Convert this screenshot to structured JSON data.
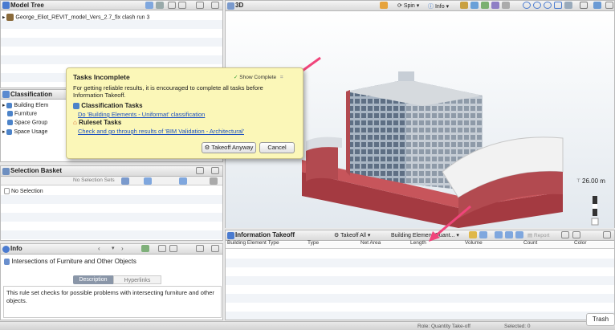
{
  "model_tree": {
    "title": "Model Tree",
    "item": "George_Eliot_REVIT_model_Vers_2.7_fix clash run 3"
  },
  "classification": {
    "title": "Classification",
    "items": [
      "Building Elem",
      "Furniture",
      "Space Group",
      "Space Usage"
    ]
  },
  "selection_basket": {
    "title": "Selection Basket",
    "sets_label": "No Selection Sets",
    "empty": "No Selection"
  },
  "info": {
    "title": "Info",
    "heading": "Intersections of Furniture and Other Objects",
    "tab_description": "Description",
    "tab_hyperlinks": "Hyperlinks",
    "body": "This rule set checks for possible problems with intersecting furniture and other objects."
  },
  "view3d": {
    "title": "3D",
    "spin": "Spin",
    "info": "Info",
    "scale": "26.00 m"
  },
  "popup": {
    "title": "Tasks Incomplete",
    "show_complete": "Show Complete",
    "message": "For getting reliable results, it is encouraged to complete all tasks before Information Takeoff.",
    "section1": "Classification Tasks",
    "link1": "Do 'Building Elements - Uniformat' classification",
    "section2": "Ruleset Tasks",
    "link2": "Check and go through results of 'BIM Validation - Architectural'",
    "takeoff_anyway": "Takeoff Anyway",
    "cancel": "Cancel"
  },
  "takeoff": {
    "title": "Information Takeoff",
    "takeoff_all": "Takeoff All",
    "dropdown": "Building Element Quant...",
    "report": "Report",
    "columns": [
      "Building Element Type",
      "Type",
      "Net Area",
      "Length",
      "Volume",
      "Count",
      "Color"
    ]
  },
  "status": {
    "text1": "Role: Quantity Take-off",
    "text2": "Selected: 0",
    "trash": "Trash"
  },
  "colors": {
    "accent_link": "#1a4fc0",
    "arrow": "#f0457b",
    "popup_bg": "#fbf7b8",
    "building": "#b2464c"
  }
}
